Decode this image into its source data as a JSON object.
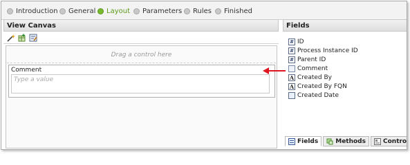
{
  "wizard_steps": [
    {
      "label": "Introduction",
      "active": false
    },
    {
      "label": "General",
      "active": false
    },
    {
      "label": "Layout",
      "active": true
    },
    {
      "label": "Parameters",
      "active": false
    },
    {
      "label": "Rules",
      "active": false
    },
    {
      "label": "Finished",
      "active": false
    }
  ],
  "view_canvas": {
    "title": "View Canvas",
    "toolbar_icons": [
      "wand-icon",
      "add-table-icon",
      "edit-form-icon"
    ],
    "drop_hint": "Drag a control here",
    "control": {
      "label": "Comment",
      "placeholder": "Type a value"
    }
  },
  "fields_panel": {
    "title": "Fields",
    "items": [
      {
        "label": "ID",
        "icon": "number-icon"
      },
      {
        "label": "Process Instance ID",
        "icon": "number-icon"
      },
      {
        "label": "Parent ID",
        "icon": "number-icon"
      },
      {
        "label": "Comment",
        "icon": "memo-icon"
      },
      {
        "label": "Created By",
        "icon": "text-icon"
      },
      {
        "label": "Created By FQN",
        "icon": "text-icon"
      },
      {
        "label": "Created Date",
        "icon": "date-icon"
      }
    ],
    "tabs": [
      {
        "label": "Fields",
        "icon": "fields-icon",
        "active": true
      },
      {
        "label": "Methods",
        "icon": "methods-icon",
        "active": false
      },
      {
        "label": "Controls",
        "icon": "controls-icon",
        "active": false
      }
    ]
  },
  "colors": {
    "active_step": "#7ab830",
    "annotation_arrow": "#e0141e"
  }
}
